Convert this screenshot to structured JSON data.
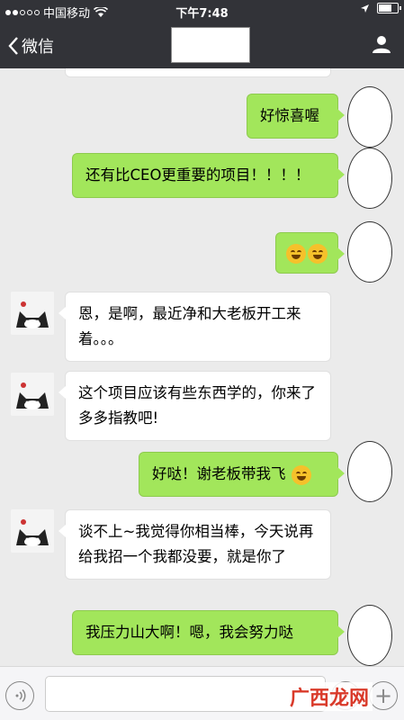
{
  "status_bar": {
    "carrier": "中国移动",
    "time": "下午7:48"
  },
  "nav": {
    "back_label": "微信"
  },
  "messages": [
    {
      "side": "right",
      "text": "好惊喜喔"
    },
    {
      "side": "right",
      "text": "还有比CEO更重要的项目！！！！"
    },
    {
      "side": "right",
      "emojis": [
        "tears-of-joy",
        "tears-of-joy"
      ]
    },
    {
      "side": "left",
      "text": "恩，是啊，最近净和大老板开工来着。。。"
    },
    {
      "side": "left",
      "text": "这个项目应该有些东西学的，你来了多多指教吧!"
    },
    {
      "side": "right",
      "text": "好哒！谢老板带我飞",
      "emoji": "heart-eyes"
    },
    {
      "side": "left",
      "text": "谈不上~我觉得你相当棒，今天说再给我招一个我都没要，就是你了"
    },
    {
      "side": "right",
      "text": "我压力山大啊！嗯，我会努力哒"
    }
  ],
  "watermark": "广西龙网",
  "colors": {
    "nav_bg": "#323338",
    "bubble_right": "#a2e65b",
    "bubble_left": "#ffffff",
    "chat_bg": "#ebebeb"
  }
}
